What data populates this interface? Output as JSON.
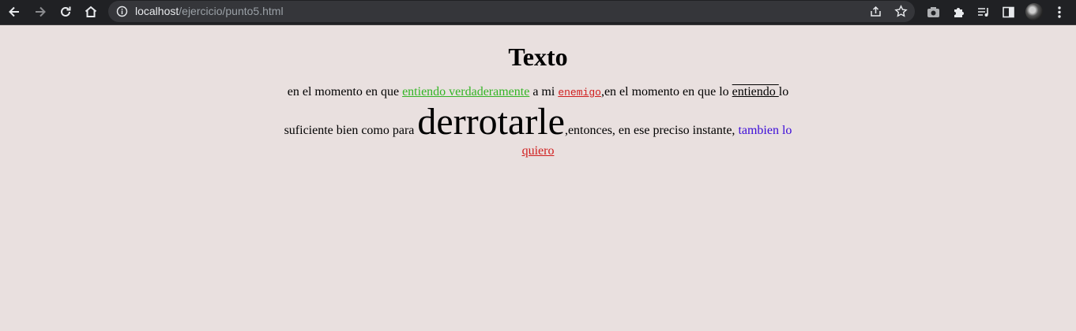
{
  "browser": {
    "url_host": "localhost",
    "url_path": "/ejercicio/punto5.html"
  },
  "page": {
    "title": "Texto",
    "p1": "en el momento en que ",
    "p2": "entiendo verdaderamente",
    "p3": " a mi ",
    "p4": "enemigo",
    "p5": ",en el momento en que lo ",
    "p6": "entiendo ",
    "p7": "lo suficiente bien como para ",
    "p8": "derrotarle",
    "p9": ",entonces, en ese preciso instante, ",
    "p10": "tambien lo",
    "p11": " quiero"
  },
  "colors": {
    "background": "#e9e0df",
    "toolbar": "#202124",
    "green": "#33b525",
    "red": "#d01d1d",
    "blue": "#3b0bd8"
  }
}
